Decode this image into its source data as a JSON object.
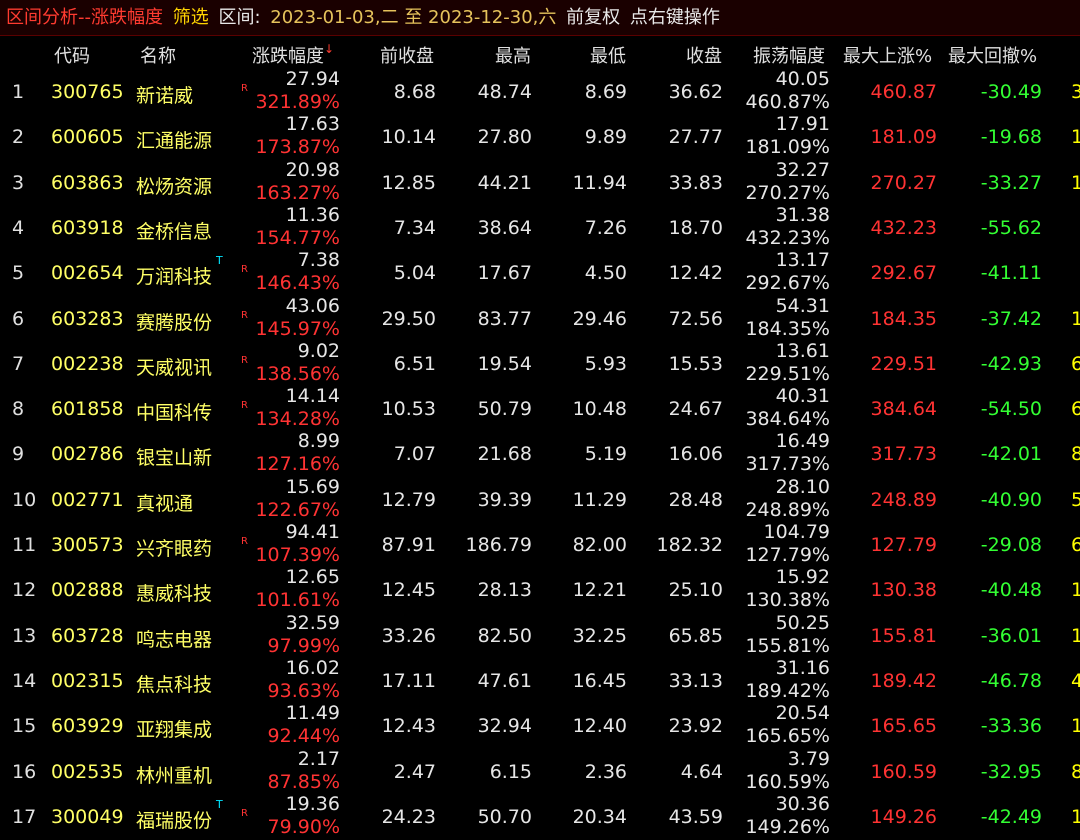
{
  "title": {
    "module": "区间分析--涨跌幅度",
    "filter": "筛选",
    "range_label": "区间:",
    "range_value": "2023-01-03,二 至 2023-12-30,六",
    "adjust": "前复权",
    "hint": "点右键操作"
  },
  "columns": {
    "code": "代码",
    "name": "名称",
    "change": "涨跌幅度",
    "prev_close": "前收盘",
    "high": "最高",
    "low": "最低",
    "close": "收盘",
    "amplitude": "振荡幅度",
    "max_rise": "最大上涨%",
    "max_drawdown": "最大回撤%"
  },
  "sort_arrow": "↓",
  "rows": [
    {
      "idx": "1",
      "code": "300765",
      "name": "新诺威",
      "t": "",
      "r": "R",
      "chg": "27.94",
      "pct": "321.89%",
      "prev": "8.68",
      "high": "48.74",
      "low": "8.69",
      "close": "36.62",
      "amp": "40.05",
      "amp_pct": "460.87%",
      "rise": "460.87",
      "draw": "-30.49",
      "extra": "3"
    },
    {
      "idx": "2",
      "code": "600605",
      "name": "汇通能源",
      "t": "",
      "r": "",
      "chg": "17.63",
      "pct": "173.87%",
      "prev": "10.14",
      "high": "27.80",
      "low": "9.89",
      "close": "27.77",
      "amp": "17.91",
      "amp_pct": "181.09%",
      "rise": "181.09",
      "draw": "-19.68",
      "extra": "1"
    },
    {
      "idx": "3",
      "code": "603863",
      "name": "松炀资源",
      "t": "",
      "r": "",
      "chg": "20.98",
      "pct": "163.27%",
      "prev": "12.85",
      "high": "44.21",
      "low": "11.94",
      "close": "33.83",
      "amp": "32.27",
      "amp_pct": "270.27%",
      "rise": "270.27",
      "draw": "-33.27",
      "extra": "1"
    },
    {
      "idx": "4",
      "code": "603918",
      "name": "金桥信息",
      "t": "",
      "r": "",
      "chg": "11.36",
      "pct": "154.77%",
      "prev": "7.34",
      "high": "38.64",
      "low": "7.26",
      "close": "18.70",
      "amp": "31.38",
      "amp_pct": "432.23%",
      "rise": "432.23",
      "draw": "-55.62",
      "extra": ""
    },
    {
      "idx": "5",
      "code": "002654",
      "name": "万润科技",
      "t": "T",
      "r": "R",
      "chg": "7.38",
      "pct": "146.43%",
      "prev": "5.04",
      "high": "17.67",
      "low": "4.50",
      "close": "12.42",
      "amp": "13.17",
      "amp_pct": "292.67%",
      "rise": "292.67",
      "draw": "-41.11",
      "extra": ""
    },
    {
      "idx": "6",
      "code": "603283",
      "name": "赛腾股份",
      "t": "",
      "r": "R",
      "chg": "43.06",
      "pct": "145.97%",
      "prev": "29.50",
      "high": "83.77",
      "low": "29.46",
      "close": "72.56",
      "amp": "54.31",
      "amp_pct": "184.35%",
      "rise": "184.35",
      "draw": "-37.42",
      "extra": "1"
    },
    {
      "idx": "7",
      "code": "002238",
      "name": "天威视讯",
      "t": "",
      "r": "R",
      "chg": "9.02",
      "pct": "138.56%",
      "prev": "6.51",
      "high": "19.54",
      "low": "5.93",
      "close": "15.53",
      "amp": "13.61",
      "amp_pct": "229.51%",
      "rise": "229.51",
      "draw": "-42.93",
      "extra": "6"
    },
    {
      "idx": "8",
      "code": "601858",
      "name": "中国科传",
      "t": "",
      "r": "R",
      "chg": "14.14",
      "pct": "134.28%",
      "prev": "10.53",
      "high": "50.79",
      "low": "10.48",
      "close": "24.67",
      "amp": "40.31",
      "amp_pct": "384.64%",
      "rise": "384.64",
      "draw": "-54.50",
      "extra": "6"
    },
    {
      "idx": "9",
      "code": "002786",
      "name": "银宝山新",
      "t": "",
      "r": "",
      "chg": "8.99",
      "pct": "127.16%",
      "prev": "7.07",
      "high": "21.68",
      "low": "5.19",
      "close": "16.06",
      "amp": "16.49",
      "amp_pct": "317.73%",
      "rise": "317.73",
      "draw": "-42.01",
      "extra": "8"
    },
    {
      "idx": "10",
      "code": "002771",
      "name": "真视通",
      "t": "",
      "r": "",
      "chg": "15.69",
      "pct": "122.67%",
      "prev": "12.79",
      "high": "39.39",
      "low": "11.29",
      "close": "28.48",
      "amp": "28.10",
      "amp_pct": "248.89%",
      "rise": "248.89",
      "draw": "-40.90",
      "extra": "5"
    },
    {
      "idx": "11",
      "code": "300573",
      "name": "兴齐眼药",
      "t": "",
      "r": "R",
      "chg": "94.41",
      "pct": "107.39%",
      "prev": "87.91",
      "high": "186.79",
      "low": "82.00",
      "close": "182.32",
      "amp": "104.79",
      "amp_pct": "127.79%",
      "rise": "127.79",
      "draw": "-29.08",
      "extra": "6"
    },
    {
      "idx": "12",
      "code": "002888",
      "name": "惠威科技",
      "t": "",
      "r": "",
      "chg": "12.65",
      "pct": "101.61%",
      "prev": "12.45",
      "high": "28.13",
      "low": "12.21",
      "close": "25.10",
      "amp": "15.92",
      "amp_pct": "130.38%",
      "rise": "130.38",
      "draw": "-40.48",
      "extra": "1"
    },
    {
      "idx": "13",
      "code": "603728",
      "name": "鸣志电器",
      "t": "",
      "r": "",
      "chg": "32.59",
      "pct": "97.99%",
      "prev": "33.26",
      "high": "82.50",
      "low": "32.25",
      "close": "65.85",
      "amp": "50.25",
      "amp_pct": "155.81%",
      "rise": "155.81",
      "draw": "-36.01",
      "extra": "1"
    },
    {
      "idx": "14",
      "code": "002315",
      "name": "焦点科技",
      "t": "",
      "r": "",
      "chg": "16.02",
      "pct": "93.63%",
      "prev": "17.11",
      "high": "47.61",
      "low": "16.45",
      "close": "33.13",
      "amp": "31.16",
      "amp_pct": "189.42%",
      "rise": "189.42",
      "draw": "-46.78",
      "extra": "4"
    },
    {
      "idx": "15",
      "code": "603929",
      "name": "亚翔集成",
      "t": "",
      "r": "",
      "chg": "11.49",
      "pct": "92.44%",
      "prev": "12.43",
      "high": "32.94",
      "low": "12.40",
      "close": "23.92",
      "amp": "20.54",
      "amp_pct": "165.65%",
      "rise": "165.65",
      "draw": "-33.36",
      "extra": "1"
    },
    {
      "idx": "16",
      "code": "002535",
      "name": "林州重机",
      "t": "",
      "r": "",
      "chg": "2.17",
      "pct": "87.85%",
      "prev": "2.47",
      "high": "6.15",
      "low": "2.36",
      "close": "4.64",
      "amp": "3.79",
      "amp_pct": "160.59%",
      "rise": "160.59",
      "draw": "-32.95",
      "extra": "8"
    },
    {
      "idx": "17",
      "code": "300049",
      "name": "福瑞股份",
      "t": "T",
      "r": "R",
      "chg": "19.36",
      "pct": "79.90%",
      "prev": "24.23",
      "high": "50.70",
      "low": "20.34",
      "close": "43.59",
      "amp": "30.36",
      "amp_pct": "149.26%",
      "rise": "149.26",
      "draw": "-42.49",
      "extra": "1"
    }
  ]
}
